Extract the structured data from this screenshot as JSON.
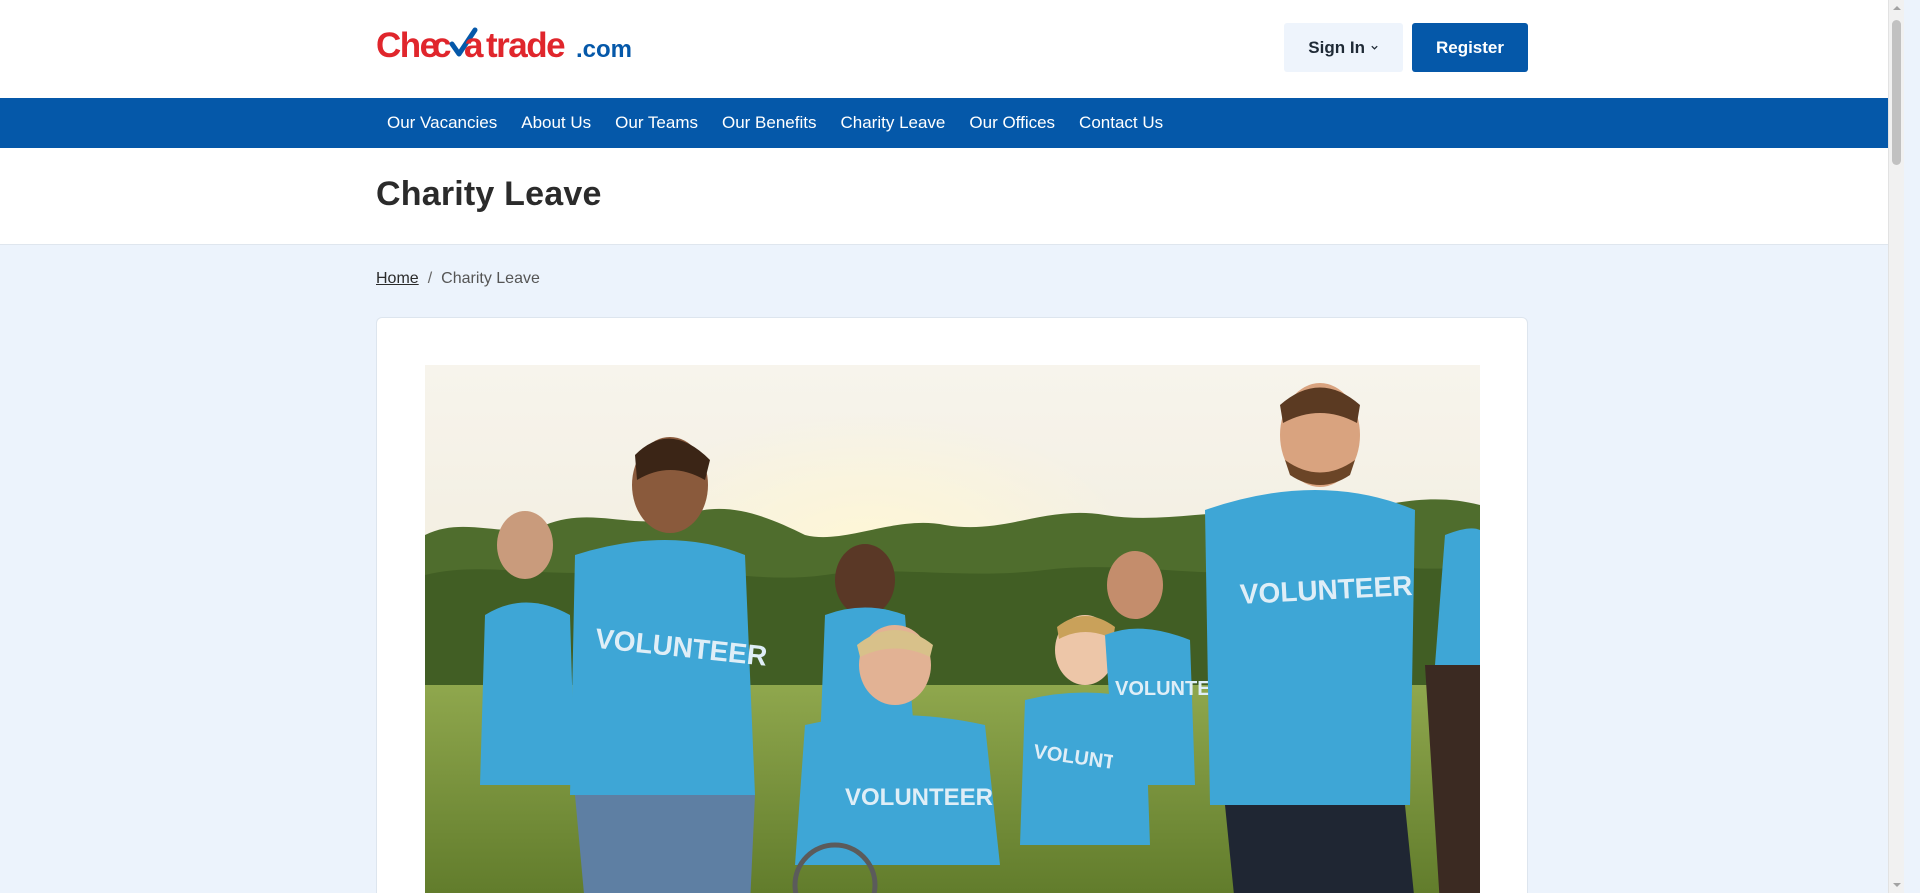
{
  "brand": {
    "logo_part1": "Check",
    "logo_part2": "a",
    "logo_part3": "trade",
    "logo_part4": ".com",
    "red": "#e0262c",
    "blue": "#0558a9"
  },
  "header": {
    "signin_label": "Sign In",
    "register_label": "Register"
  },
  "nav": {
    "items": [
      {
        "label": "Our Vacancies"
      },
      {
        "label": "About Us"
      },
      {
        "label": "Our Teams"
      },
      {
        "label": "Our Benefits"
      },
      {
        "label": "Charity Leave"
      },
      {
        "label": "Our Offices"
      },
      {
        "label": "Contact Us"
      }
    ]
  },
  "page": {
    "title": "Charity Leave"
  },
  "breadcrumb": {
    "home": "Home",
    "separator": "/",
    "current": "Charity Leave"
  },
  "hero": {
    "shirt_text": "VOLUNTEER",
    "shirt_color": "#3ea6d6"
  },
  "icons": {
    "signin_chevron": "chevron-down-icon",
    "scroll_up": "chevron-up-icon",
    "scroll_down": "chevron-down-icon"
  }
}
